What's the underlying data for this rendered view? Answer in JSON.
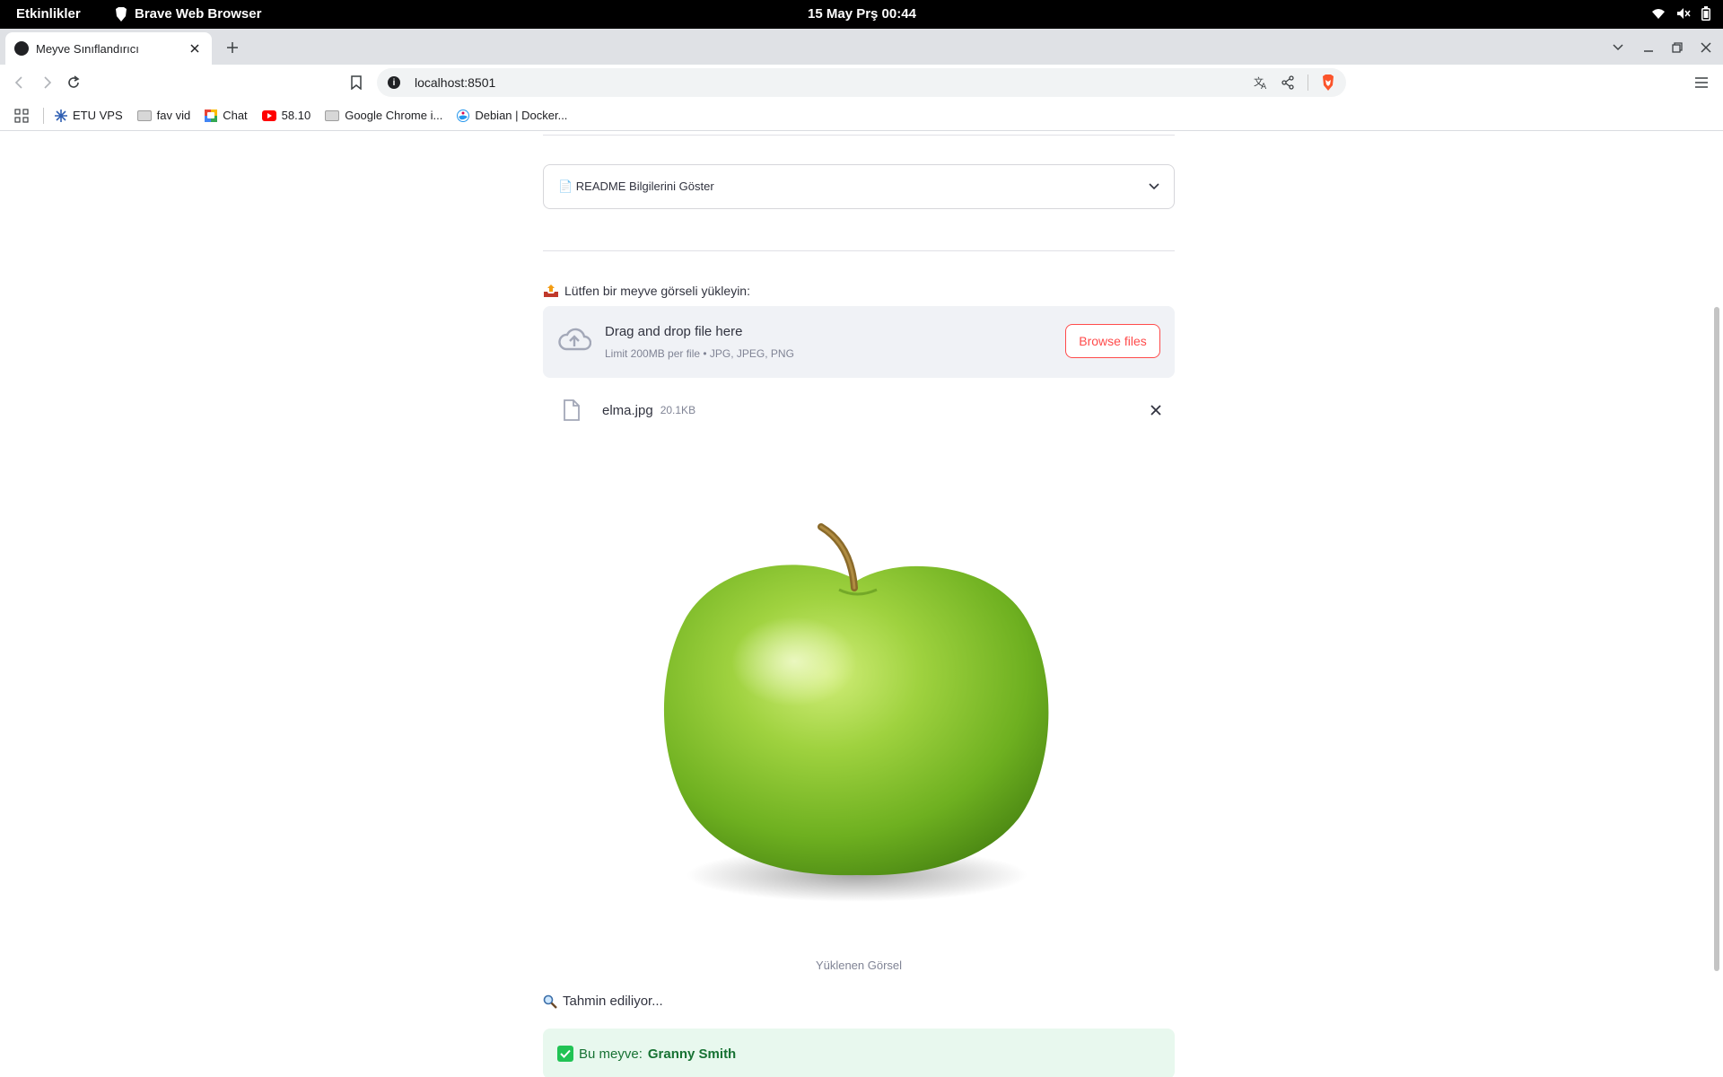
{
  "system": {
    "activities": "Etkinlikler",
    "app_name": "Brave Web Browser",
    "clock": "15 May Prş  00:44"
  },
  "browser": {
    "tab_title": "Meyve Sınıflandırıcı",
    "url": "localhost:8501",
    "bookmarks": [
      {
        "label": "ETU VPS",
        "icon": "snowflake-icon"
      },
      {
        "label": "fav vid",
        "icon": "folder-icon"
      },
      {
        "label": "Chat",
        "icon": "chat-icon"
      },
      {
        "label": "58.10",
        "icon": "youtube-icon"
      },
      {
        "label": "Google Chrome i...",
        "icon": "folder-icon"
      },
      {
        "label": "Debian | Docker...",
        "icon": "docker-icon"
      }
    ]
  },
  "app": {
    "expander_label": "📄 README Bilgilerini Göster",
    "upload_label": "Lütfen bir meyve görseli yükleyin:",
    "dropzone_title": "Drag and drop file here",
    "dropzone_limit": "Limit 200MB per file • JPG, JPEG, PNG",
    "browse_button": "Browse files",
    "file_name": "elma.jpg",
    "file_size": "20.1KB",
    "image_caption": "Yüklenen Görsel",
    "predicting_text": "Tahmin ediliyor...",
    "result_prefix": "Bu meyve:",
    "result_value": "Granny Smith"
  },
  "colors": {
    "accent": "#ff4b4b",
    "success_bg": "#e8f8ee",
    "success_text": "#177233",
    "apple_green": "#7cc12e"
  }
}
